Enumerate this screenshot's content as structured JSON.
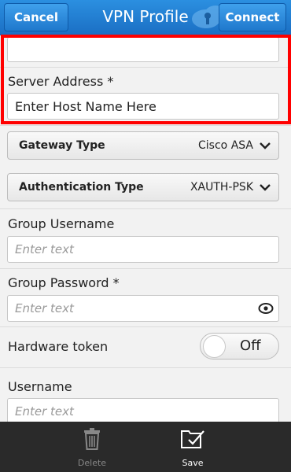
{
  "header": {
    "cancel_label": "Cancel",
    "title": "VPN Profile",
    "connect_label": "Connect"
  },
  "fields": {
    "server_address_label": "Server Address *",
    "server_address_value": "Enter Host Name Here",
    "gateway_type_label": "Gateway Type",
    "gateway_type_value": "Cisco ASA",
    "auth_type_label": "Authentication Type",
    "auth_type_value": "XAUTH-PSK",
    "group_username_label": "Group Username",
    "group_username_placeholder": "Enter text",
    "group_password_label": "Group Password *",
    "group_password_placeholder": "Enter text",
    "hardware_token_label": "Hardware token",
    "hardware_token_value": "Off",
    "username_label": "Username",
    "username_placeholder": "Enter text"
  },
  "bottom_bar": {
    "delete_label": "Delete",
    "save_label": "Save"
  },
  "colors": {
    "header": "#1b6fc4",
    "highlight": "#ff0000",
    "bottom_bar": "#2a2a2a"
  }
}
